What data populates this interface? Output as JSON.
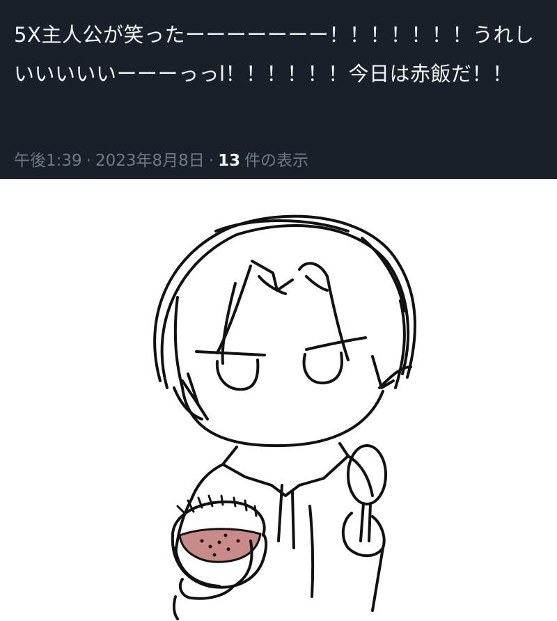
{
  "tweet": {
    "text": "5X主人公が笑ったーーーーーーー！！！！！！！うれしいいいいいーーーっっl！！！！！！今日は赤飯だ！！",
    "time": "午後1:39",
    "separator": "·",
    "date": "2023年8月8日",
    "views_count": "13",
    "views_label": "件の表示"
  },
  "colors": {
    "panel_background": "#1a2029",
    "text_primary": "#f3f4f6",
    "text_secondary": "#6e7a86",
    "rice_fill": "#c98a8a"
  },
  "illustration": {
    "subject": "sketch-of-character-holding-bowl-of-red-bean-rice-and-spoon"
  }
}
